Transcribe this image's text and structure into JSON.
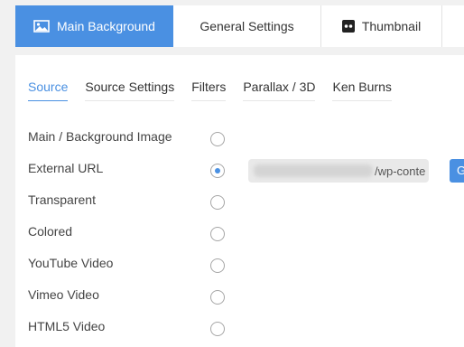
{
  "tabs": [
    {
      "label": "Main Background",
      "icon": "image-icon",
      "active": true
    },
    {
      "label": "General Settings",
      "active": false
    },
    {
      "label": "Thumbnail",
      "icon": "thumbnail-icon",
      "active": false
    }
  ],
  "subtabs": [
    {
      "label": "Source",
      "active": true
    },
    {
      "label": "Source Settings",
      "active": false
    },
    {
      "label": "Filters",
      "active": false
    },
    {
      "label": "Parallax / 3D",
      "active": false
    },
    {
      "label": "Ken Burns",
      "active": false
    }
  ],
  "options": [
    {
      "label": "Main / Background Image",
      "selected": false
    },
    {
      "label": "External URL",
      "selected": true
    },
    {
      "label": "Transparent",
      "selected": false
    },
    {
      "label": "Colored",
      "selected": false
    },
    {
      "label": "YouTube Video",
      "selected": false
    },
    {
      "label": "Vimeo Video",
      "selected": false
    },
    {
      "label": "HTML5 Video",
      "selected": false
    }
  ],
  "external_url": {
    "visible_text": "/wp-conte",
    "button_label": "G"
  },
  "colors": {
    "accent": "#4a90e2",
    "background": "#f1f1f1",
    "panel": "#ffffff",
    "text": "#444444"
  }
}
